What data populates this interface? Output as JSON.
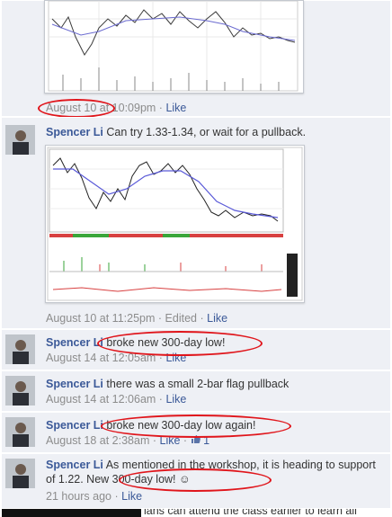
{
  "comments": [
    {
      "time": "August 10 at 10:09pm",
      "like": "Like"
    },
    {
      "author": "Spencer Li",
      "text": "Can try 1.33-1.34, or wait for a pullback.",
      "time": "August 10 at 11:25pm",
      "edited": "Edited",
      "like": "Like"
    },
    {
      "author": "Spencer Li",
      "text": "broke new 300-day low!",
      "time": "August 14 at 12:05am",
      "like": "Like"
    },
    {
      "author": "Spencer Li",
      "text": "there was a small 2-bar flag pullback",
      "time": "August 14 at 12:06am",
      "like": "Like"
    },
    {
      "author": "Spencer Li",
      "text": "broke new 300-day low again!",
      "time": "August 18 at 2:38am",
      "like": "Like",
      "like_count": "1"
    },
    {
      "author": "Spencer Li",
      "text": "As mentioned in the workshop, it is heading to support of 1.22. New 300-day low! ☺",
      "time": "21 hours ago",
      "like": "Like"
    }
  ],
  "partial_bottom_text": "lans can attend the class earlier to learn all",
  "sep": "·"
}
